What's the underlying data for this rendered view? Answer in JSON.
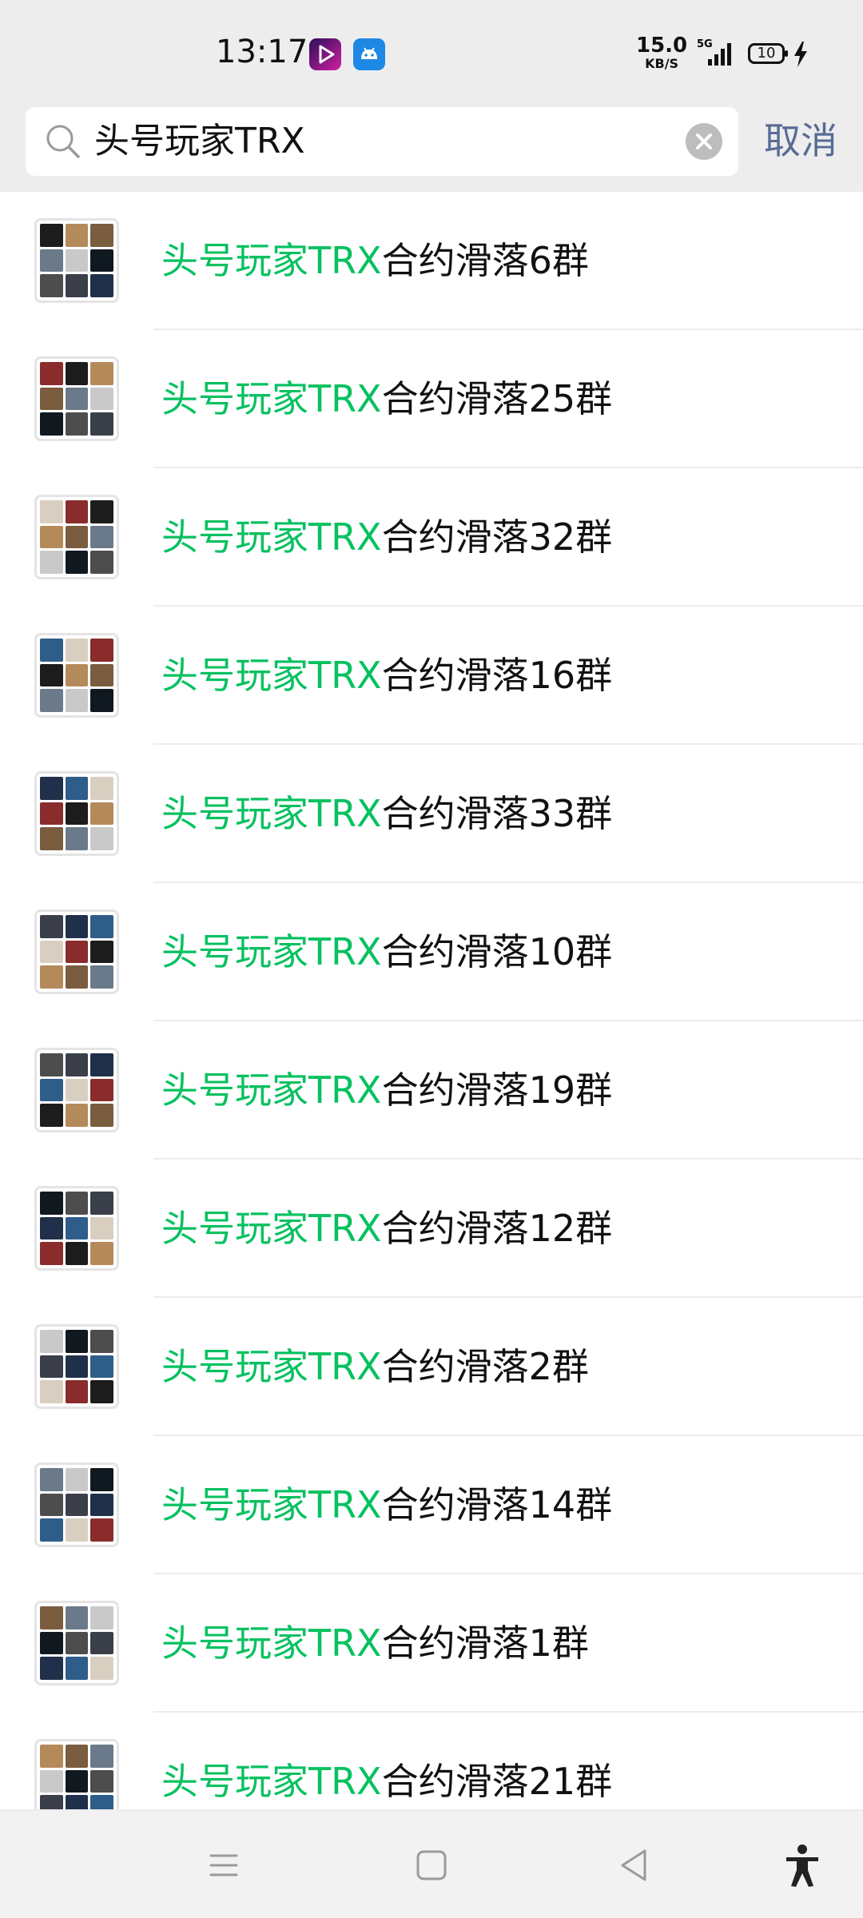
{
  "status_bar": {
    "time": "13:17",
    "net_speed_value": "15.0",
    "net_speed_unit": "KB/S",
    "network": "5G",
    "battery": "10",
    "icons": [
      "video-app-icon",
      "android-app-icon",
      "signal-icon",
      "battery-icon",
      "charging-icon"
    ]
  },
  "search": {
    "query": "头号玩家TRX",
    "cancel_label": "取消"
  },
  "results": [
    {
      "highlight": "头号玩家TRX",
      "rest": "合约滑落6群"
    },
    {
      "highlight": "头号玩家TRX",
      "rest": "合约滑落25群"
    },
    {
      "highlight": "头号玩家TRX",
      "rest": "合约滑落32群"
    },
    {
      "highlight": "头号玩家TRX",
      "rest": "合约滑落16群"
    },
    {
      "highlight": "头号玩家TRX",
      "rest": "合约滑落33群"
    },
    {
      "highlight": "头号玩家TRX",
      "rest": "合约滑落10群"
    },
    {
      "highlight": "头号玩家TRX",
      "rest": "合约滑落19群"
    },
    {
      "highlight": "头号玩家TRX",
      "rest": "合约滑落12群"
    },
    {
      "highlight": "头号玩家TRX",
      "rest": "合约滑落2群"
    },
    {
      "highlight": "头号玩家TRX",
      "rest": "合约滑落14群"
    },
    {
      "highlight": "头号玩家TRX",
      "rest": "合约滑落1群"
    },
    {
      "highlight": "头号玩家TRX",
      "rest": "合约滑落21群"
    }
  ],
  "colors": {
    "highlight": "#07c160",
    "cancel": "#576b95",
    "background": "#ededed"
  },
  "nav_bar": {
    "icons": [
      "menu-icon",
      "home-icon",
      "back-icon",
      "accessibility-icon"
    ]
  }
}
